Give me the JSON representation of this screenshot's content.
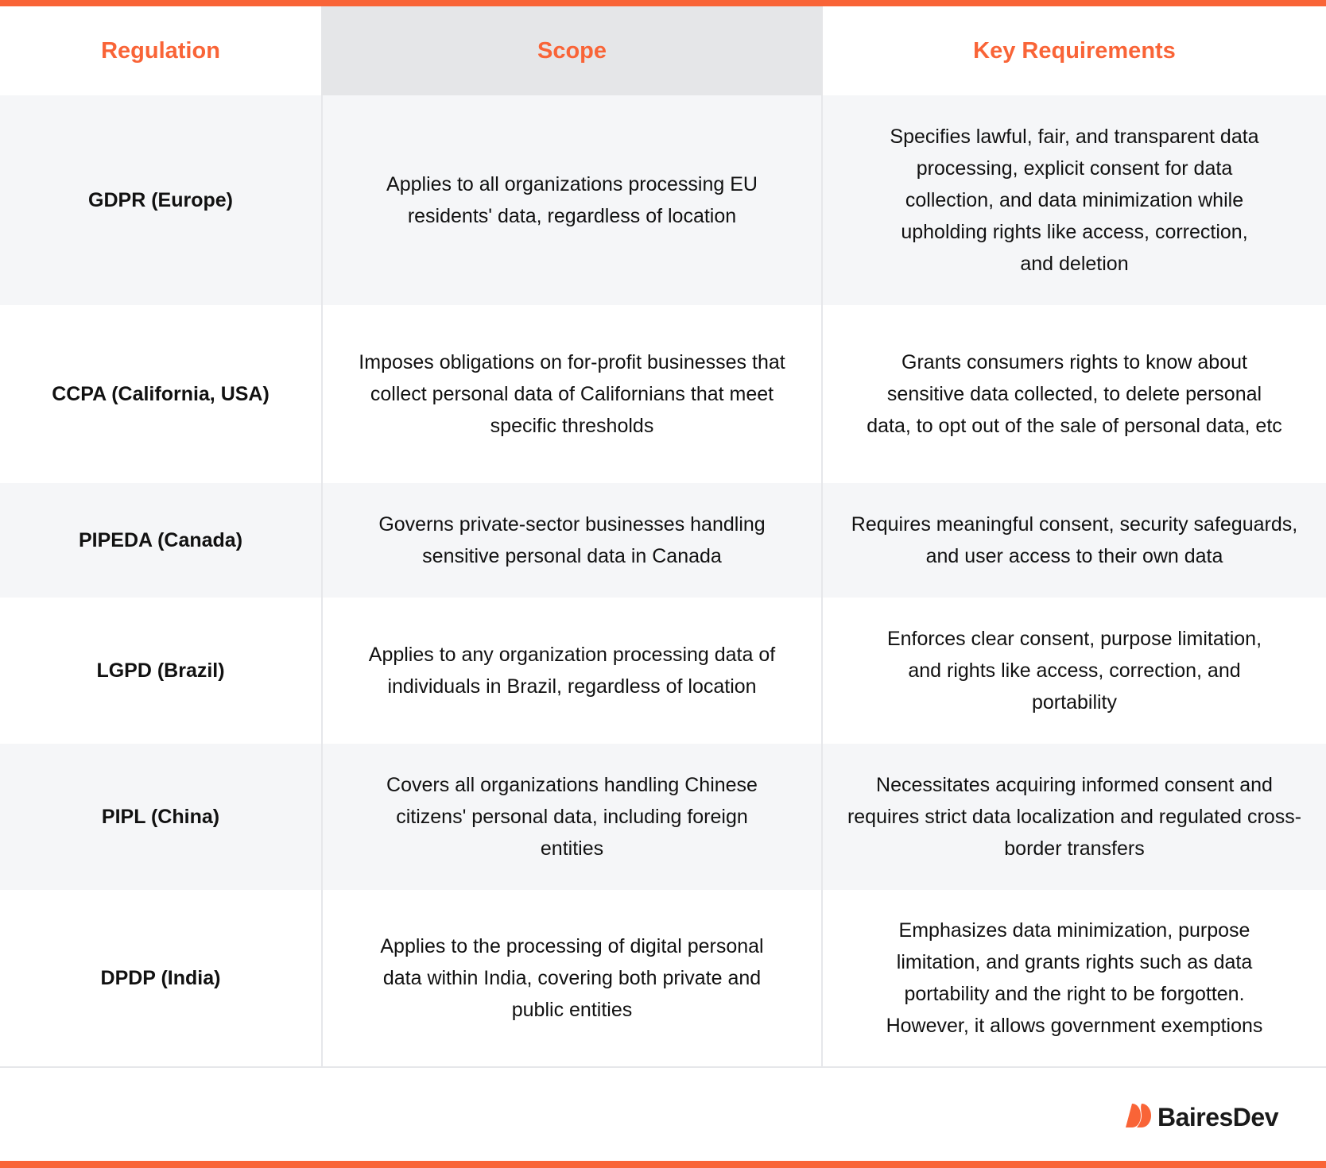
{
  "header": {
    "columns": [
      "Regulation",
      "Scope",
      "Key Requirements"
    ]
  },
  "rows": [
    {
      "regulation": "GDPR (Europe)",
      "scope": "Applies to all organizations processing EU residents' data, regardless of location",
      "requirements": "Specifies lawful, fair, and transparent data processing, explicit consent for data collection, and data minimization while upholding rights like access, correction, and deletion"
    },
    {
      "regulation": "CCPA (California, USA)",
      "scope": "Imposes obligations on for-profit businesses that collect personal data of Californians that meet specific thresholds",
      "requirements": "Grants consumers rights to know about sensitive data collected, to delete personal data, to opt out of the sale of personal data, etc"
    },
    {
      "regulation": "PIPEDA (Canada)",
      "scope": "Governs private-sector businesses handling sensitive personal data in Canada",
      "requirements": "Requires meaningful consent, security safeguards, and user access to their own data"
    },
    {
      "regulation": "LGPD (Brazil)",
      "scope": "Applies to any organization processing data of individuals in Brazil, regardless of location",
      "requirements": "Enforces clear consent, purpose limitation, and rights like access, correction, and portability"
    },
    {
      "regulation": "PIPL (China)",
      "scope": "Covers all organizations handling Chinese citizens' personal data, including foreign entities",
      "requirements": "Necessitates acquiring informed consent and requires strict data localization and regulated cross-border transfers"
    },
    {
      "regulation": "DPDP (India)",
      "scope": "Applies to the processing of digital personal data within India, covering both private and public entities",
      "requirements": "Emphasizes data minimization, purpose limitation, and grants rights such as data portability and the right to be forgotten. However, it allows government exemptions"
    }
  ],
  "footer": {
    "brand": "BairesDev",
    "logo_icon": "bairesdev-logo-icon"
  },
  "colors": {
    "accent": "#f96437",
    "row_alt": "#f5f6f8",
    "header_scope_bg": "#e5e6e8",
    "text": "#111111"
  }
}
